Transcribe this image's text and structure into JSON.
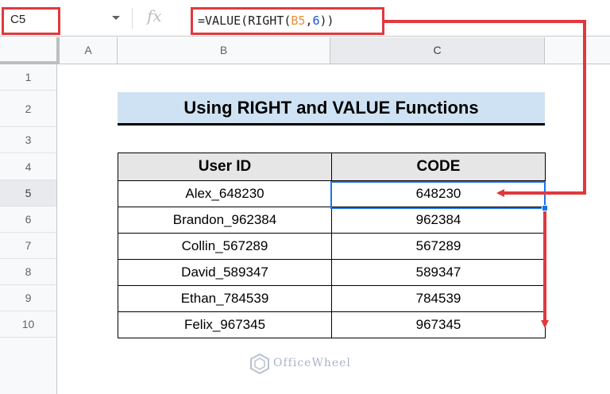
{
  "formula_bar": {
    "name_box": "C5",
    "fx_symbol": "fx",
    "formula_prefix": "=VALUE(RIGHT(",
    "formula_ref": "B5",
    "formula_comma": ",",
    "formula_num": "6",
    "formula_suffix": "))"
  },
  "columns": [
    "A",
    "B",
    "C"
  ],
  "rows": [
    "1",
    "2",
    "3",
    "4",
    "5",
    "6",
    "7",
    "8",
    "9",
    "10"
  ],
  "title": "Using RIGHT and VALUE Functions",
  "table": {
    "headers": [
      "User ID",
      "CODE"
    ],
    "rows": [
      [
        "Alex_648230",
        "648230"
      ],
      [
        "Brandon_962384",
        "962384"
      ],
      [
        "Collin_567289",
        "567289"
      ],
      [
        "David_589347",
        "589347"
      ],
      [
        "Ethan_784539",
        "784539"
      ],
      [
        "Felix_967345",
        "967345"
      ]
    ]
  },
  "watermark": "OfficeWheel",
  "colors": {
    "highlight": "#e0393e",
    "selection": "#1a73e8",
    "title_fill": "#cfe2f3",
    "header_fill": "#e7e6e6"
  }
}
